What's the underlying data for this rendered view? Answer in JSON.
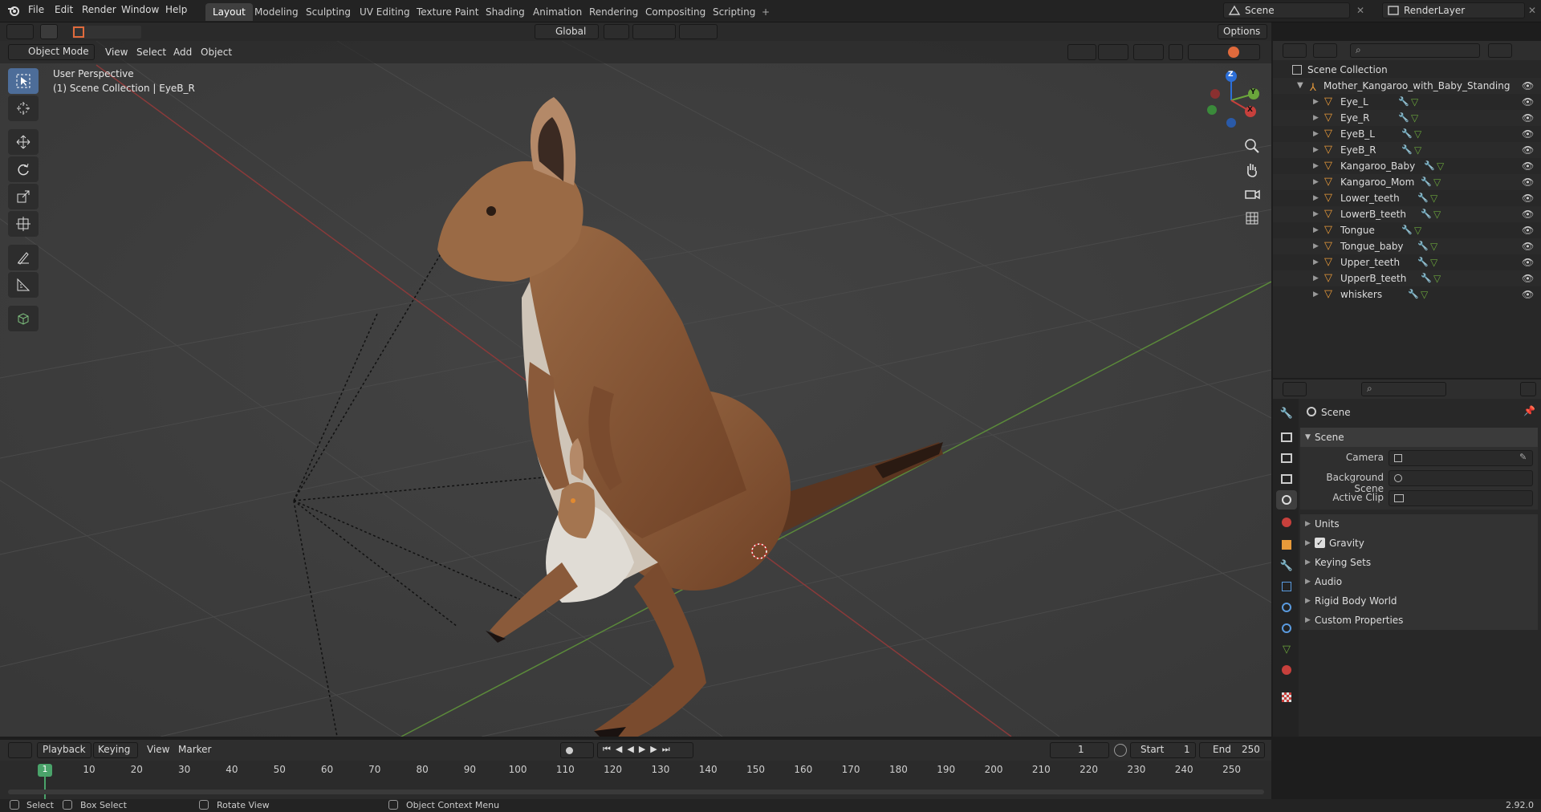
{
  "menus": [
    "File",
    "Edit",
    "Render",
    "Window",
    "Help"
  ],
  "workspace_tabs": [
    "Layout",
    "Modeling",
    "Sculpting",
    "UV Editing",
    "Texture Paint",
    "Shading",
    "Animation",
    "Rendering",
    "Compositing",
    "Scripting"
  ],
  "active_tab": "Layout",
  "add_tab": "+",
  "scene_name": "Scene",
  "render_layer": "RenderLayer",
  "viewport": {
    "mode": "Object Mode",
    "menus": [
      "View",
      "Select",
      "Add",
      "Object"
    ],
    "transform_orientation": "Global",
    "options_label": "Options",
    "overlay_title": "User Perspective",
    "overlay_subtitle": "(1) Scene Collection | EyeB_R",
    "gizmo_axes": [
      "Z",
      "Y",
      "X"
    ]
  },
  "outliner": {
    "root": "Scene Collection",
    "object": "Mother_Kangaroo_with_Baby_Standing",
    "children": [
      "Eye_L",
      "Eye_R",
      "EyeB_L",
      "EyeB_R",
      "Kangaroo_Baby",
      "Kangaroo_Mom",
      "Lower_teeth",
      "LowerB_teeth",
      "Tongue",
      "Tongue_baby",
      "Upper_teeth",
      "UpperB_teeth",
      "whiskers"
    ]
  },
  "properties": {
    "context": "Scene",
    "panel": "Scene",
    "fields": [
      {
        "label": "Camera"
      },
      {
        "label": "Background Scene"
      },
      {
        "label": "Active Clip"
      }
    ],
    "subpanels": [
      "Units",
      "Gravity",
      "Keying Sets",
      "Audio",
      "Rigid Body World",
      "Custom Properties"
    ],
    "gravity_checked": true
  },
  "timeline": {
    "menus": [
      "Playback",
      "Keying",
      "View",
      "Marker"
    ],
    "current_frame": "1",
    "start_label": "Start",
    "start": "1",
    "end_label": "End",
    "end": "250",
    "ticks": [
      "10",
      "20",
      "30",
      "40",
      "50",
      "60",
      "70",
      "80",
      "90",
      "100",
      "110",
      "120",
      "130",
      "140",
      "150",
      "160",
      "170",
      "180",
      "190",
      "200",
      "210",
      "220",
      "230",
      "240",
      "250"
    ],
    "playhead": "1"
  },
  "status": {
    "select": "Select",
    "box_select": "Box Select",
    "rotate": "Rotate View",
    "context_menu": "Object Context Menu",
    "version": "2.92.0"
  },
  "colors": {
    "accent": "#4d6d99",
    "object_orange": "#e89a3a",
    "axis_red": "#c7403c",
    "axis_green": "#6aa53b"
  }
}
